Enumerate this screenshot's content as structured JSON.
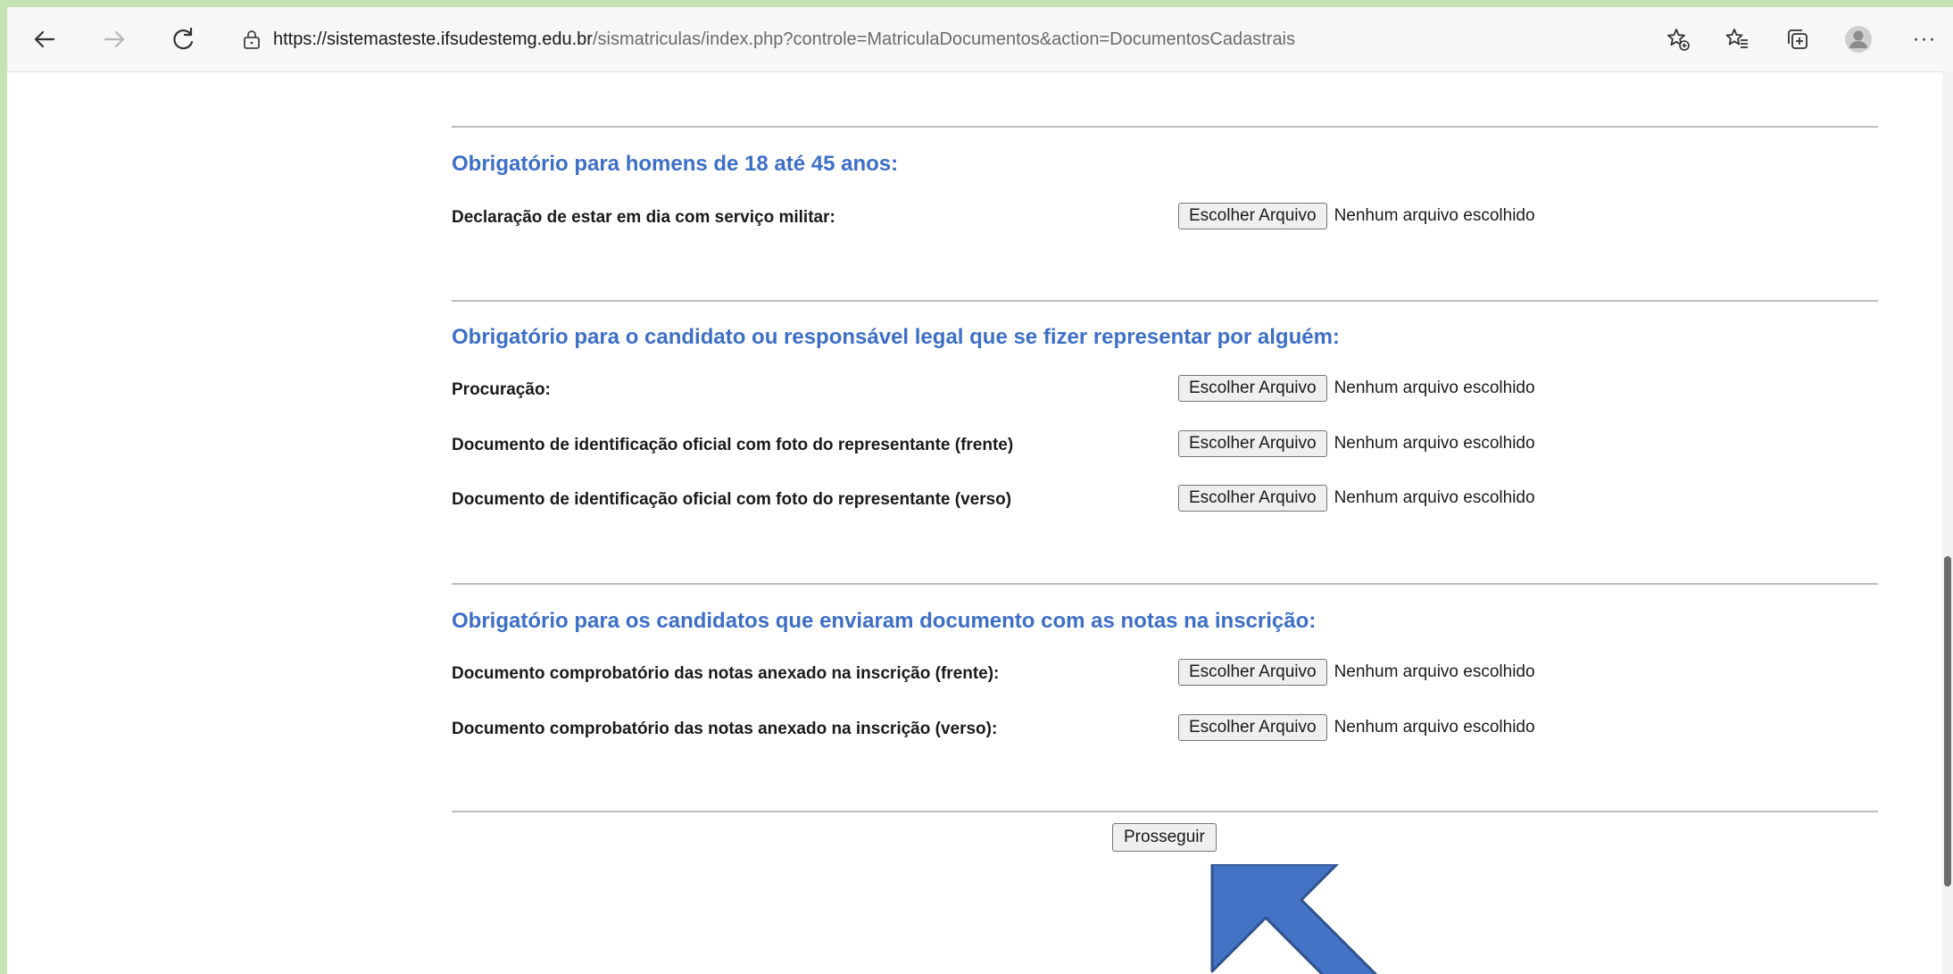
{
  "browser": {
    "url_host": "https://sistemasteste.ifsudestemg.edu.br",
    "url_path": "/sismatriculas/index.php?controle=MatriculaDocumentos&action=DocumentosCadastrais",
    "icons": [
      "back-arrow-icon",
      "forward-arrow-icon",
      "refresh-icon",
      "lock-icon",
      "favorite-add-icon",
      "favorites-icon",
      "collections-icon",
      "profile-icon",
      "more-icon"
    ],
    "more_label": "···"
  },
  "sections": [
    {
      "title": "Obrigatório para homens de 18 até 45 anos:",
      "fields": [
        {
          "label": "Declaração de estar em dia com serviço militar:",
          "button": "Escolher Arquivo",
          "status": "Nenhum arquivo escolhido"
        }
      ]
    },
    {
      "title": "Obrigatório para o candidato ou responsável legal que se fizer representar por alguém:",
      "fields": [
        {
          "label": "Procuração:",
          "button": "Escolher Arquivo",
          "status": "Nenhum arquivo escolhido"
        },
        {
          "label": "Documento de identificação oficial com foto do representante (frente)",
          "button": "Escolher Arquivo",
          "status": "Nenhum arquivo escolhido"
        },
        {
          "label": "Documento de identificação oficial com foto do representante (verso)",
          "button": "Escolher Arquivo",
          "status": "Nenhum arquivo escolhido"
        }
      ]
    },
    {
      "title": "Obrigatório para os candidatos que enviaram documento com as notas na inscrição:",
      "fields": [
        {
          "label": "Documento comprobatório das notas anexado na inscrição (frente):",
          "button": "Escolher Arquivo",
          "status": "Nenhum arquivo escolhido"
        },
        {
          "label": "Documento comprobatório das notas anexado na inscrição (verso):",
          "button": "Escolher Arquivo",
          "status": "Nenhum arquivo escolhido"
        }
      ]
    }
  ],
  "submit_label": "Prosseguir",
  "colors": {
    "section_title": "#3d6fc7",
    "arrow": "#4472c4",
    "frame_border": "#c5e3b5"
  }
}
